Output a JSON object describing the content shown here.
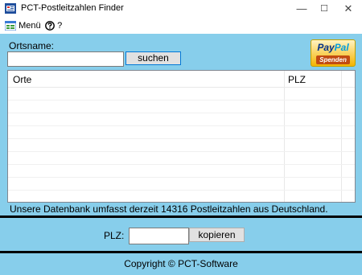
{
  "window": {
    "title": "PCT-Postleitzahlen Finder",
    "controls": {
      "minimize": "—",
      "maximize": "☐",
      "close": "✕"
    }
  },
  "menu": {
    "items": [
      {
        "label": "Menü",
        "icon": "menu-grid-icon"
      },
      {
        "label": "?",
        "icon": "help-icon"
      }
    ]
  },
  "search": {
    "label": "Ortsname:",
    "value": "",
    "button": "suchen"
  },
  "donate": {
    "logo_pay": "Pay",
    "logo_pal": "Pal",
    "sub": "Spenden"
  },
  "results": {
    "columns": [
      "Orte",
      "PLZ"
    ],
    "rows": []
  },
  "info_text": "Unsere Datenbank umfasst derzeit 14316 Postleitzahlen aus Deutschland.",
  "plz": {
    "label": "PLZ:",
    "value": "",
    "button": "kopieren"
  },
  "footer": {
    "copyright": "Copyright © PCT-Software"
  },
  "colors": {
    "panel": "#87ceeb",
    "divider": "#000000",
    "accent_border": "#0078d7"
  }
}
